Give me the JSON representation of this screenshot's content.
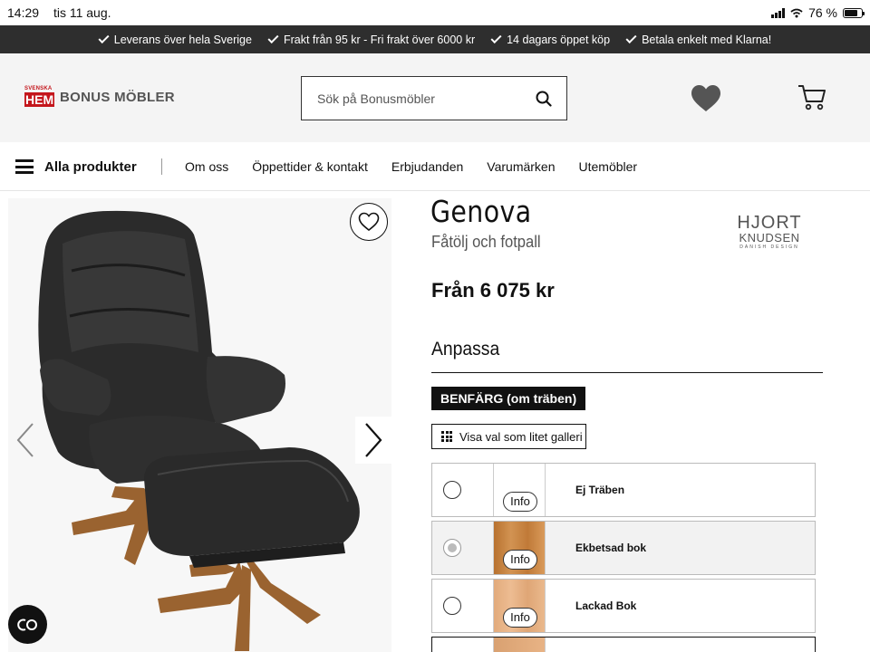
{
  "status_bar": {
    "time": "14:29",
    "date": "tis 11 aug.",
    "battery": "76 %",
    "battery_level": 0.76
  },
  "usp_bar": {
    "items": [
      "Leverans över hela Sverige",
      "Frakt från 95 kr - Fri frakt över 6000 kr",
      "14 dagars öppet köp",
      "Betala enkelt med Klarna!"
    ]
  },
  "header": {
    "logo_small": "SVENSKA",
    "logo_mark": "HEM",
    "logo_text": "BONUS MÖBLER",
    "search_placeholder": "Sök på Bonusmöbler",
    "icons": [
      "search-icon",
      "heart-icon",
      "cart-icon"
    ]
  },
  "nav": {
    "all_products": "Alla produkter",
    "links": [
      "Om oss",
      "Öppettider & kontakt",
      "Erbjudanden",
      "Varumärken",
      "Utemöbler"
    ]
  },
  "product": {
    "title": "Genova",
    "subtitle": "Fåtölj och fotpall",
    "price": "Från 6 075 kr",
    "brand": {
      "line1": "HJORT",
      "line2": "KNUDSEN",
      "line3": "DANISH DESIGN"
    }
  },
  "customize": {
    "heading": "Anpassa",
    "option_label": "BENFÄRG (om träben)",
    "gallery_button": "Visa val som litet galleri",
    "options": [
      {
        "name": "Ej Träben",
        "info": "Info",
        "swatch_color": "#ffffff",
        "selected": false
      },
      {
        "name": "Ekbetsad bok",
        "info": "Info",
        "swatch_color": "#c9843f",
        "selected": true
      },
      {
        "name": "Lackad Bok",
        "info": "Info",
        "swatch_color": "#e7b386",
        "selected": false
      }
    ]
  },
  "colors": {
    "usp_bg": "#2e2e2e",
    "header_bg": "#f4f4f4",
    "accent": "#111111",
    "logo_red": "#c4161c"
  }
}
